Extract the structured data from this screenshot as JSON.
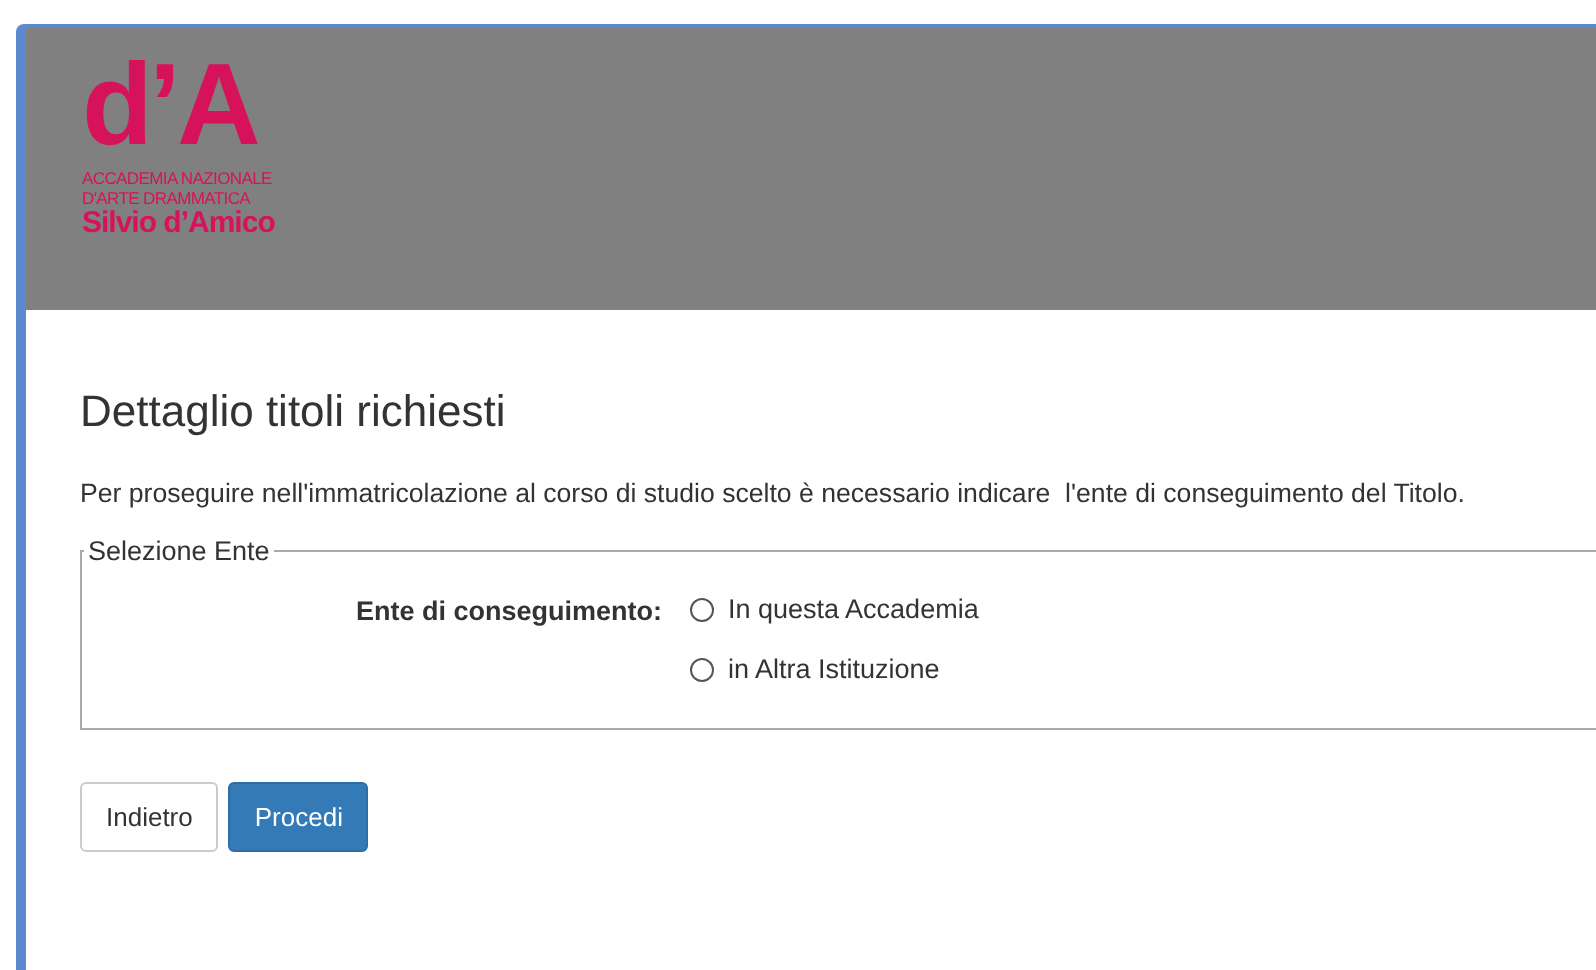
{
  "header": {
    "logo": {
      "mark": "d’A",
      "lines": [
        "ACCADEMIA NAZIONALE",
        "D'ARTE DRAMMATICA"
      ],
      "name": "Silvio d’Amico"
    }
  },
  "page": {
    "title": "Dettaglio titoli richiesti",
    "intro": "Per proseguire nell'immatricolazione al corso di studio scelto è necessario indicare  l'ente di conseguimento del Titolo."
  },
  "fieldset": {
    "legend": "Selezione Ente",
    "label": "Ente di conseguimento:",
    "options": [
      {
        "label": "In questa Accademia",
        "selected": false
      },
      {
        "label": "in Altra Istituzione",
        "selected": false
      }
    ]
  },
  "buttons": [
    {
      "label": "Indietro",
      "kind": "secondary"
    },
    {
      "label": "Procedi",
      "kind": "primary"
    }
  ]
}
